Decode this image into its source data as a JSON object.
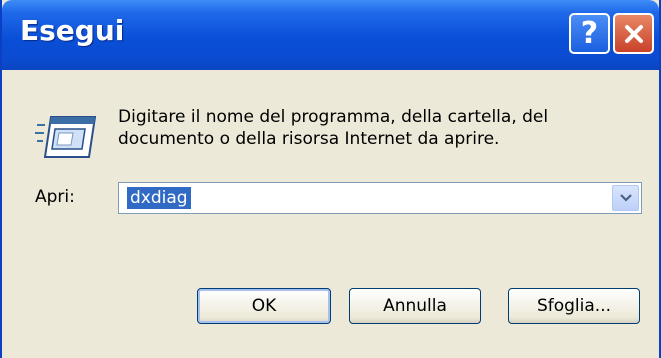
{
  "window": {
    "title": "Esegui",
    "help_icon": "?",
    "close_icon": "✕"
  },
  "dialog": {
    "description_line1": "Digitare il nome del programma, della cartella, del",
    "description_line2": "documento o della risorsa Internet da aprire.",
    "open_label": "Apri:",
    "open_value": "dxdiag",
    "icon": "run-dialog-icon"
  },
  "buttons": {
    "ok": "OK",
    "cancel": "Annulla",
    "browse": "Sfoglia..."
  },
  "colors": {
    "titlebar": "#0a4fd8",
    "dialog_bg": "#ece9d8",
    "selection": "#316ac5",
    "close": "#c8412a"
  }
}
